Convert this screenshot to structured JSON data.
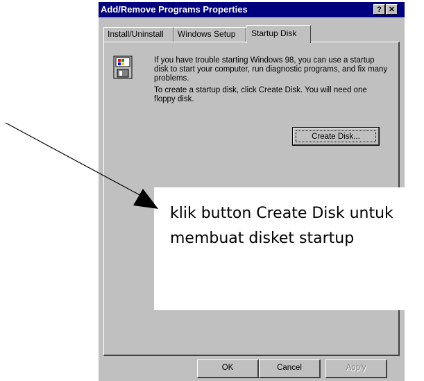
{
  "window": {
    "title": "Add/Remove Programs Properties",
    "help_label": "?",
    "close_label": "✕"
  },
  "tabs": [
    {
      "label": "Install/Uninstall"
    },
    {
      "label": "Windows Setup"
    },
    {
      "label": "Startup Disk",
      "active": true
    }
  ],
  "panel": {
    "icon": "floppy-disk-icon",
    "info_text": "If you have trouble starting Windows 98, you can use a startup disk to start your computer, run diagnostic programs, and fix many problems.",
    "instruction_text": "To create a startup disk, click Create Disk. You will need one floppy disk.",
    "create_disk_label": "Create Disk..."
  },
  "footer": {
    "ok_label": "OK",
    "cancel_label": "Cancel",
    "apply_label": "Apply"
  },
  "annotation": {
    "line1": "klik button Create Disk untuk",
    "line2": "membuat disket startup"
  }
}
